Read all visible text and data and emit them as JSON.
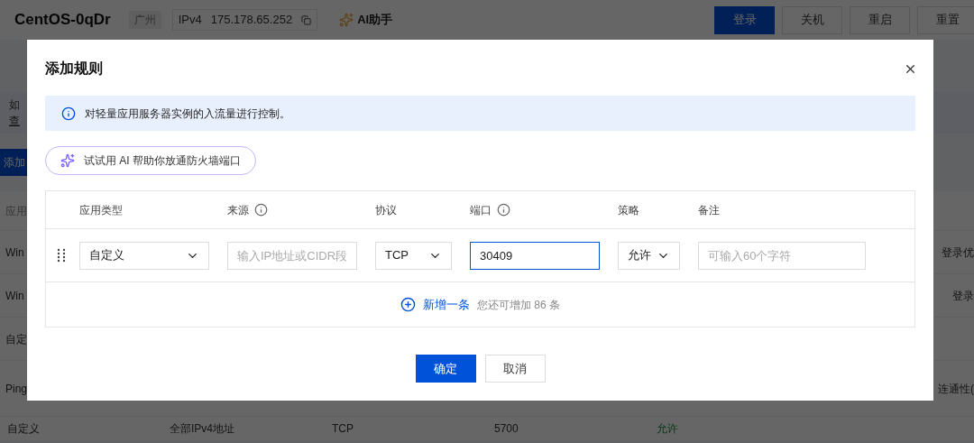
{
  "background": {
    "header": {
      "title": "CentOS-0qDr",
      "region": "广州",
      "ip_label": "IPv4",
      "ip": "175.178.65.252",
      "ai_label": "AI助手",
      "buttons": [
        {
          "label": "登录",
          "kind": "primary"
        },
        {
          "label": "关机",
          "kind": "default"
        },
        {
          "label": "重启",
          "kind": "default"
        },
        {
          "label": "重置",
          "kind": "default"
        }
      ]
    },
    "notice": [
      "如",
      "查"
    ],
    "add_button": "添加",
    "table_header": "应用",
    "rows": [
      {
        "left": "Win",
        "right": "登录优"
      },
      {
        "left": "Win",
        "right": "登录"
      },
      {
        "left": "自定",
        "right": ""
      },
      {
        "left": "Ping",
        "right": "连通性("
      }
    ],
    "bottom_row": [
      {
        "text": "自定义",
        "kind": "text"
      },
      {
        "text": "全部IPv4地址",
        "kind": "text"
      },
      {
        "text": "TCP",
        "kind": "text"
      },
      {
        "text": "5700",
        "kind": "text"
      },
      {
        "text": "允许",
        "kind": "status"
      }
    ]
  },
  "dialog": {
    "title": "添加规则",
    "info": "对轻量应用服务器实例的入流量进行控制。",
    "ai_button": "试试用 AI 帮助你放通防火墙端口",
    "columns": [
      {
        "label": "应用类型",
        "info": false
      },
      {
        "label": "来源",
        "info": true
      },
      {
        "label": "协议",
        "info": false
      },
      {
        "label": "端口",
        "info": true
      },
      {
        "label": "策略",
        "info": false
      },
      {
        "label": "备注",
        "info": false
      }
    ],
    "row": [
      {
        "kind": "select",
        "value": "自定义"
      },
      {
        "kind": "input",
        "placeholder": "输入IP地址或CIDR段",
        "focused": false
      },
      {
        "kind": "select",
        "value": "TCP"
      },
      {
        "kind": "input",
        "value": "30409",
        "focused": true
      },
      {
        "kind": "select",
        "value": "允许"
      },
      {
        "kind": "input",
        "placeholder": "可输入60个字符",
        "focused": false
      }
    ],
    "add_link": "新增一条",
    "add_hint": "您还可增加 86 条",
    "buttons": [
      {
        "label": "确定",
        "kind": "primary"
      },
      {
        "label": "取消",
        "kind": "default"
      }
    ]
  }
}
